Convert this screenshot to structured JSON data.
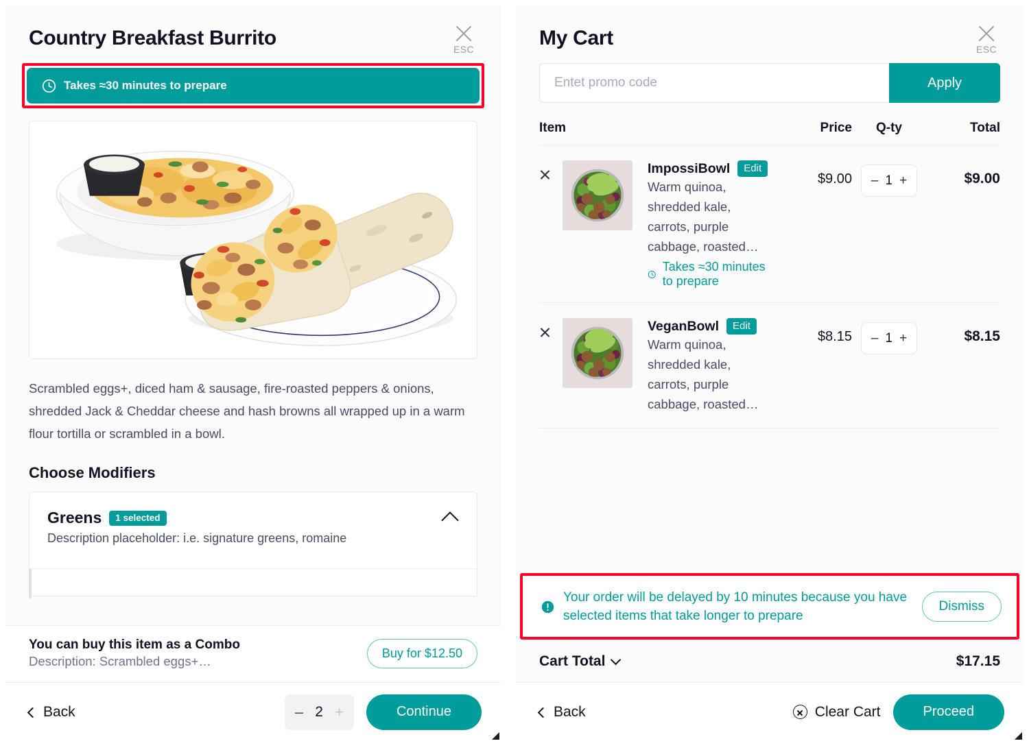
{
  "colors": {
    "accent_teal": "#009B9B",
    "alert_outline_red": "#FF0028",
    "text_dark": "#101223",
    "text_muted": "#474C66",
    "panel_bg": "#FBFBFB"
  },
  "item_panel": {
    "title": "Country Breakfast Burrito",
    "close": {
      "icon": "close-icon",
      "label": "ESC"
    },
    "prep_banner": {
      "icon": "clock-icon",
      "text": "Takes ≈30 minutes to prepare"
    },
    "photo_alt": "Breakfast burrito on a plate with a bowl of scrambled eggs and dipping sauces",
    "description": "Scrambled eggs+, diced ham & sausage, fire-roasted peppers & onions, shredded Jack & Cheddar cheese and hash browns all wrapped up in a warm flour tortilla or scrambled in a bowl.",
    "modifiers_heading": "Choose Modifiers",
    "modifiers": [
      {
        "name": "Greens",
        "badge": "1 selected",
        "description": "Description placeholder: i.e. signature greens, romaine",
        "chevron": "chevron-up-icon"
      }
    ],
    "combo": {
      "title": "You can buy this item as a Combo",
      "subtitle": "Description: Scrambled eggs+…",
      "buy_label": "Buy for $12.50"
    },
    "footer": {
      "back_label": "Back",
      "minus_label": "–",
      "quantity": "2",
      "plus_label": "+",
      "continue_label": "Continue"
    }
  },
  "cart_panel": {
    "title": "My Cart",
    "close": {
      "icon": "close-icon",
      "label": "ESC"
    },
    "promo": {
      "placeholder": "Entet promo code",
      "value": "",
      "apply_label": "Apply"
    },
    "columns": {
      "item": "Item",
      "price": "Price",
      "qty": "Q-ty",
      "total": "Total"
    },
    "items": [
      {
        "name": "ImpossiBowl",
        "edit_label": "Edit",
        "description": "Warm quinoa, shredded kale, carrots, purple cabbage, roasted…",
        "prep_note": "Takes ≈30 minutes to prepare",
        "has_prep_note": true,
        "price": "$9.00",
        "minus_label": "–",
        "quantity": "1",
        "plus_label": "+",
        "total": "$9.00",
        "thumb_alt": "Quinoa bowl with avocado, kale and falafel"
      },
      {
        "name": "VeganBowl",
        "edit_label": "Edit",
        "description": "Warm quinoa, shredded kale, carrots, purple cabbage, roasted…",
        "prep_note": "",
        "has_prep_note": false,
        "price": "$8.15",
        "minus_label": "–",
        "quantity": "1",
        "plus_label": "+",
        "total": "$8.15",
        "thumb_alt": "Quinoa bowl with avocado, kale and falafel"
      }
    ],
    "alert": {
      "icon": "exclamation-circle-icon",
      "text": "Your order will be delayed by 10 minutes because you have selected items that take longer to prepare",
      "dismiss_label": "Dismiss"
    },
    "totals": {
      "label": "Cart Total",
      "chevron": "chevron-down-icon",
      "value": "$17.15"
    },
    "footer": {
      "back_label": "Back",
      "clear_label": "Clear Cart",
      "proceed_label": "Proceed"
    }
  }
}
